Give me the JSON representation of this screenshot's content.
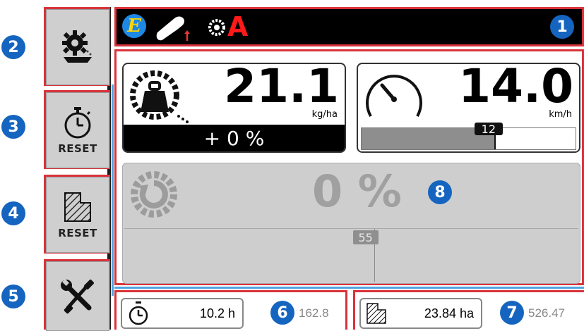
{
  "status_bar": {
    "badge": "1",
    "e_label": "E",
    "alarm_letter": "A"
  },
  "sidebar": {
    "buttons": [
      {
        "badge": "2",
        "icon": "spreader-gear-icon",
        "label": ""
      },
      {
        "badge": "3",
        "icon": "stopwatch-icon",
        "label": "RESET"
      },
      {
        "badge": "4",
        "icon": "hatched-area-icon",
        "label": "RESET"
      },
      {
        "badge": "5",
        "icon": "wrench-screwdriver-icon",
        "label": ""
      }
    ]
  },
  "main": {
    "badge": "8",
    "rate_panel": {
      "value": "21.1",
      "unit": "kg/ha",
      "adjust": "+ 0 %"
    },
    "speed_panel": {
      "value": "14.0",
      "unit": "km/h",
      "bar_value": "12",
      "bar_fill_fraction": 0.62
    },
    "disc_panel": {
      "value": "0 %",
      "bar_value": "55",
      "bar_marker_fraction": 0.55
    }
  },
  "bottom": {
    "time": {
      "badge": "6",
      "value": "10.2 h",
      "total": "162.8"
    },
    "area": {
      "badge": "7",
      "value": "23.84 ha",
      "total": "526.47"
    }
  },
  "colors": {
    "accent_red": "#d9323a",
    "badge_blue": "#1565c0",
    "status_bar_bg": "#000000"
  }
}
